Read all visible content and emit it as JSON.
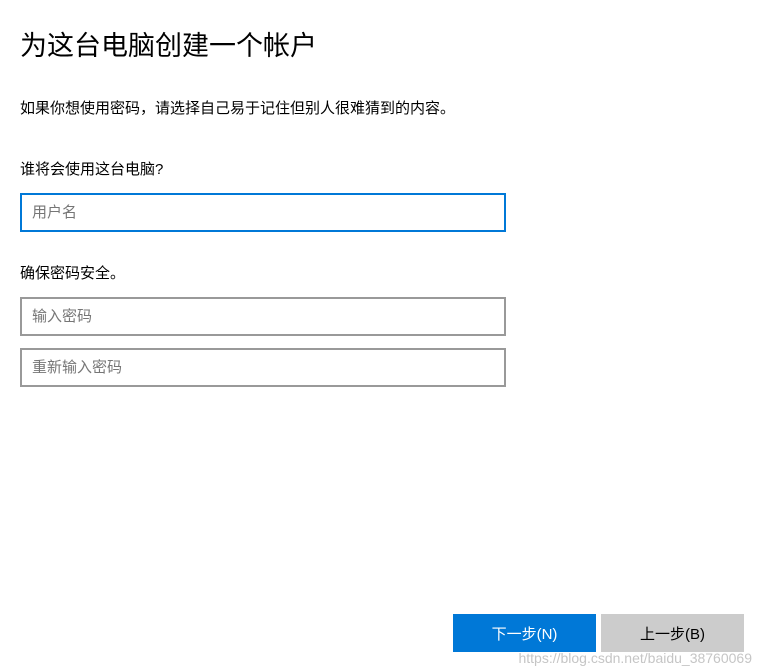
{
  "header": {
    "title": "为这台电脑创建一个帐户"
  },
  "description": "如果你想使用密码，请选择自己易于记住但别人很难猜到的内容。",
  "sections": {
    "who": {
      "label": "谁将会使用这台电脑?",
      "username_placeholder": "用户名"
    },
    "password": {
      "label": "确保密码安全。",
      "password_placeholder": "输入密码",
      "confirm_placeholder": "重新输入密码"
    }
  },
  "buttons": {
    "next": "下一步(N)",
    "back": "上一步(B)"
  },
  "watermark": "https://blog.csdn.net/baidu_38760069"
}
